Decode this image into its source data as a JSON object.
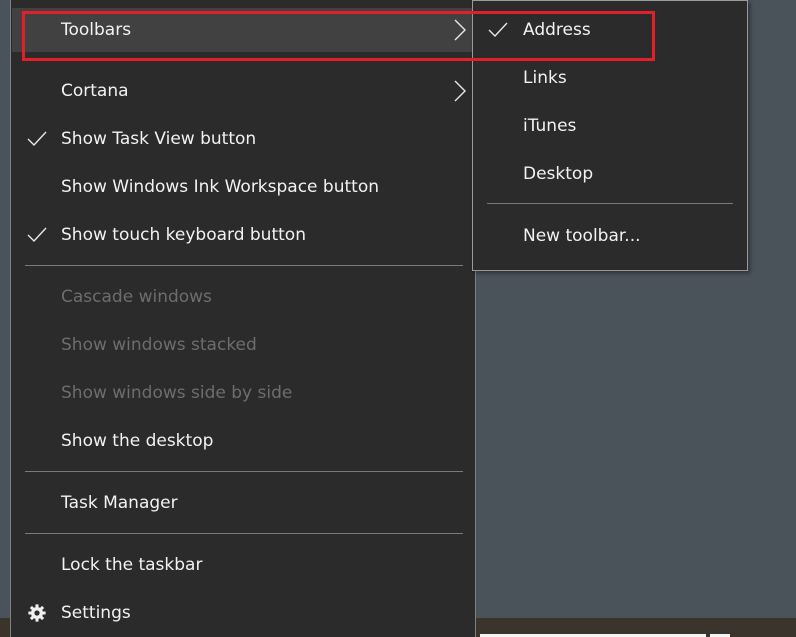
{
  "context_menu": {
    "items": [
      {
        "label": "Toolbars",
        "has_submenu": true,
        "highlighted": true
      },
      {
        "label": "Cortana",
        "has_submenu": true
      },
      {
        "label": "Show Task View button",
        "checked": true
      },
      {
        "label": "Show Windows Ink Workspace button",
        "checked": false
      },
      {
        "label": "Show touch keyboard button",
        "checked": true
      },
      {
        "label": "Cascade windows",
        "disabled": true
      },
      {
        "label": "Show windows stacked",
        "disabled": true
      },
      {
        "label": "Show windows side by side",
        "disabled": true
      },
      {
        "label": "Show the desktop"
      },
      {
        "label": "Task Manager"
      },
      {
        "label": "Lock the taskbar"
      },
      {
        "label": "Settings",
        "icon": "gear-icon"
      }
    ]
  },
  "toolbars_submenu": {
    "items": [
      {
        "label": "Address",
        "checked": true
      },
      {
        "label": "Links",
        "checked": false
      },
      {
        "label": "iTunes",
        "checked": false
      },
      {
        "label": "Desktop",
        "checked": false
      },
      {
        "label": "New toolbar..."
      }
    ]
  },
  "annotation": {
    "color": "#e3202a",
    "target": "Toolbars > Address"
  }
}
